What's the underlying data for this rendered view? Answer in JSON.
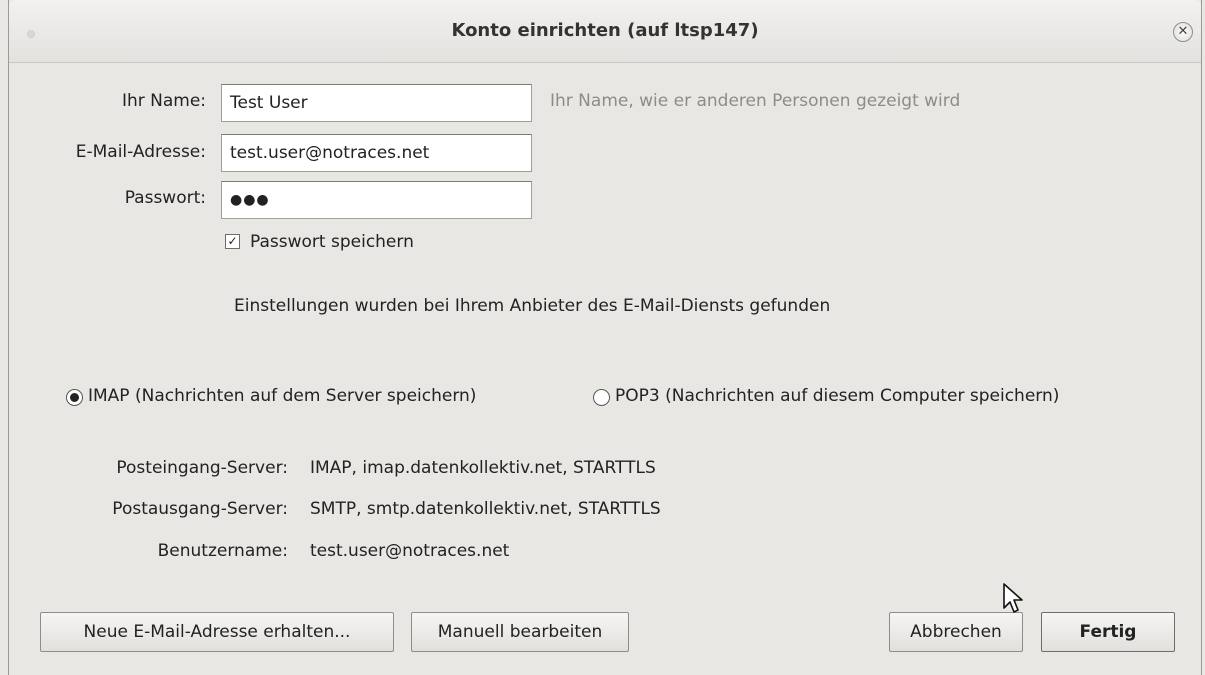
{
  "window": {
    "title": "Konto einrichten (auf ltsp147)"
  },
  "form": {
    "name_label": "Ihr Name:",
    "name_value": "Test User",
    "name_hint": "Ihr Name, wie er anderen Personen gezeigt wird",
    "email_label": "E-Mail-Adresse:",
    "email_value": "test.user@notraces.net",
    "password_label": "Passwort:",
    "password_value": "●●●",
    "save_password_label": "Passwort speichern",
    "save_password_checked": true
  },
  "status": {
    "message": "Einstellungen wurden bei Ihrem Anbieter des E-Mail-Diensts gefunden"
  },
  "protocol": {
    "imap_label": "IMAP (Nachrichten auf dem Server speichern)",
    "pop3_label": "POP3 (Nachrichten auf diesem Computer speichern)",
    "selected": "IMAP"
  },
  "servers": {
    "incoming_label": "Posteingang-Server:",
    "incoming_value": "IMAP, imap.datenkollektiv.net, STARTTLS",
    "outgoing_label": "Postausgang-Server:",
    "outgoing_value": "SMTP, smtp.datenkollektiv.net, STARTTLS",
    "username_label": "Benutzername:",
    "username_value": "test.user@notraces.net"
  },
  "buttons": {
    "new_address": "Neue E-Mail-Adresse erhalten...",
    "manual_edit": "Manuell bearbeiten",
    "cancel": "Abbrechen",
    "done": "Fertig"
  },
  "icons": {
    "close": "close-icon",
    "cursor": "mouse-pointer-icon",
    "checkbox": "checkbox-checked-icon"
  }
}
